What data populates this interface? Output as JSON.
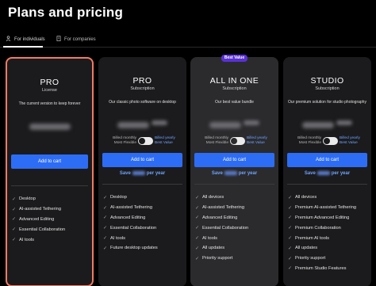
{
  "page": {
    "title": "Plans and pricing"
  },
  "tabs": [
    {
      "label": "For individuals",
      "icon": "person-icon",
      "active": true
    },
    {
      "label": "For companies",
      "icon": "building-icon",
      "active": false
    }
  ],
  "colors": {
    "accent": "#2d6df6",
    "highlight_border": "#f27b62",
    "badge": "#5a31d6",
    "link": "#6ea3ff"
  },
  "plans": [
    {
      "name": "PRO",
      "kind": "License",
      "description": "The current version to keep forever",
      "cta": "Add to cart",
      "features": [
        "Desktop",
        "AI-assisted Tethering",
        "Advanced Editing",
        "Essential Collaboration",
        "AI tools"
      ]
    },
    {
      "name": "PRO",
      "kind": "Subscription",
      "description": "Our classic photo software on desktop",
      "billing_monthly": "Billed monthly",
      "billing_monthly_sub": "Most Flexible",
      "billing_yearly": "Billed yearly",
      "billing_yearly_sub": "Best Value",
      "cta": "Add to cart",
      "save_prefix": "Save",
      "save_suffix": "per year",
      "features": [
        "Desktop",
        "AI-assisted Tethering",
        "Advanced Editing",
        "Essential Collaboration",
        "AI tools",
        "Future desktop updates"
      ]
    },
    {
      "name": "ALL IN ONE",
      "kind": "Subscription",
      "description": "Our best value bundle",
      "badge": "Best Value",
      "billing_monthly": "Billed monthly",
      "billing_monthly_sub": "Most Flexible",
      "billing_yearly": "Billed yearly",
      "billing_yearly_sub": "Best Value",
      "cta": "Add to cart",
      "save_prefix": "Save",
      "save_suffix": "per year",
      "features": [
        "All devices",
        "AI-assisted Tethering",
        "Advanced Editing",
        "Essential Collaboration",
        "AI tools",
        "All updates",
        "Priority support"
      ]
    },
    {
      "name": "STUDIO",
      "kind": "Subscription",
      "description": "Our premium solution for studio photography",
      "billing_monthly": "Billed monthly",
      "billing_monthly_sub": "Most Flexible",
      "billing_yearly": "Billed yearly",
      "billing_yearly_sub": "Best Value",
      "cta": "Add to cart",
      "save_prefix": "Save",
      "save_suffix": "per year",
      "features": [
        "All devices",
        "Premium AI-assisted Tethering",
        "Premium Advanced Editing",
        "Premium Collaboration",
        "Premium AI tools",
        "All updates",
        "Priority support",
        "Premium Studio Features"
      ]
    }
  ]
}
